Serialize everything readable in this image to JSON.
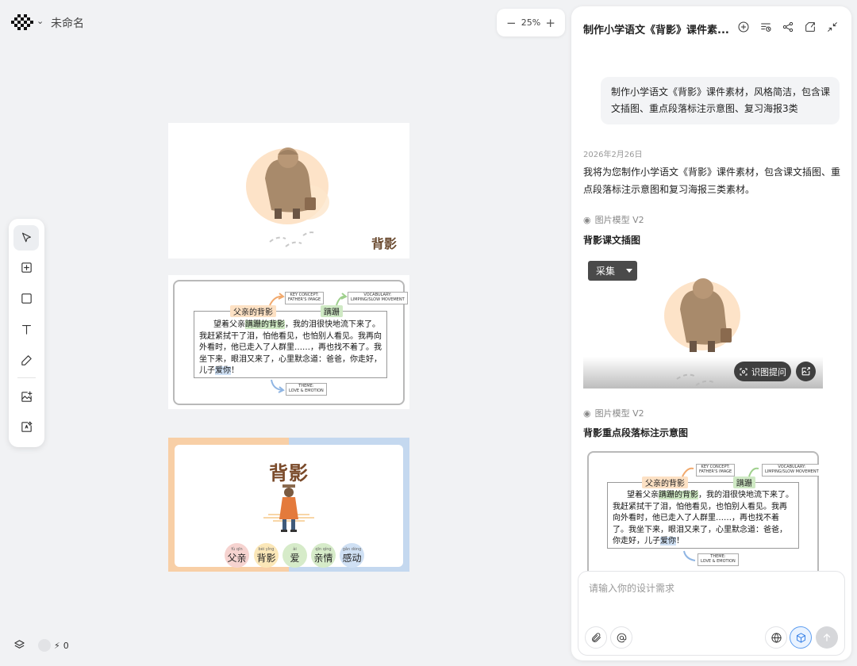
{
  "app": {
    "logo_icon": "pixel-logo-icon",
    "document_title": "未命名"
  },
  "zoom": {
    "minus": "−",
    "level": "25%",
    "plus": "+"
  },
  "toolbar": {
    "tools": [
      "select-tool",
      "frame-tool",
      "rectangle-tool",
      "text-tool",
      "pen-tool",
      "image-generate-tool",
      "ai-edit-tool"
    ]
  },
  "bottom": {
    "credits": "0"
  },
  "canvas": {
    "illustration": {
      "title": "背影"
    },
    "diagram": {
      "tag_father": "父亲的背影",
      "tag_limp": "蹒跚",
      "note_key": [
        "KEY CONCEPT:",
        "FATHER'S IMAGE"
      ],
      "note_vocab": [
        "VOCABULARY:",
        "LIMPING/SLOW MOVEMENT"
      ],
      "note_theme": [
        "THEME:",
        "LOVE & EMOTION"
      ],
      "passage": {
        "p1": "望着父亲",
        "h1": "蹒跚的背影",
        "p2": "，我的泪很快地流下来了。我赶紧拭干了泪，怕他看见，也怕别人看见。我再向外看时，他已走入了人群里……，再也找不着了。我坐下来，眼泪又来了，心里默念道：爸爸，你走好，儿子",
        "h2": "爱你",
        "p3": "！"
      }
    },
    "poster": {
      "title": "背影",
      "words": [
        {
          "pinyin": "fù qīn",
          "text": "父亲",
          "color": "#f6d3d0"
        },
        {
          "pinyin": "bèi yǐng",
          "text": "背影",
          "color": "#fbe7b8"
        },
        {
          "pinyin": "ài",
          "text": "爱",
          "color": "#d6ebc9"
        },
        {
          "pinyin": "qīn qíng",
          "text": "亲情",
          "color": "#d6ebc9"
        },
        {
          "pinyin": "gǎn dòng",
          "text": "感动",
          "color": "#cfe0f4"
        }
      ]
    }
  },
  "panel": {
    "title": "制作小学语文《背影》课件素...",
    "header_icons": [
      "new-chat-icon",
      "history-icon",
      "share-icon",
      "export-icon",
      "collapse-icon"
    ],
    "user_message": "制作小学语文《背影》课件素材，风格简洁，包含课文插图、重点段落标注示意图、复习海报3类",
    "date": "2026年2月26日",
    "assistant_message": "我将为您制作小学语文《背影》课件素材，包含课文插图、重点段落标注示意图和复习海报三类素材。",
    "model_label": "图片模型 V2",
    "item1_title": "背影课文插图",
    "collect_label": "采集",
    "recognize_label": "识图提问",
    "item2_title": "背影重点段落标注示意图",
    "input_placeholder": "请输入你的设计需求"
  }
}
